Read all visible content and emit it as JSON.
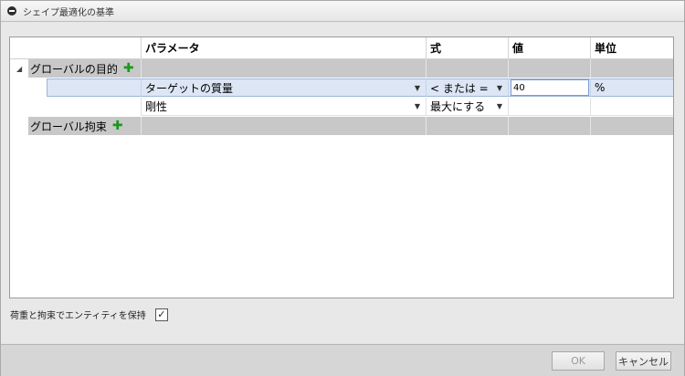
{
  "window": {
    "title": "シェイプ最適化の基準"
  },
  "grid": {
    "headers": [
      "パラメータ",
      "式",
      "値",
      "単位"
    ],
    "groups": [
      {
        "label": "グローバルの目的",
        "rows": [
          {
            "parameter": "ターゲットの質量",
            "expression": "< または =",
            "value": "40",
            "unit": "%"
          },
          {
            "parameter": "剛性",
            "expression": "最大にする",
            "value": "",
            "unit": ""
          }
        ]
      },
      {
        "label": "グローバル拘束",
        "rows": []
      }
    ]
  },
  "options": {
    "keep_loads_label": "荷重と拘束でエンティティを保持",
    "keep_loads_checked": true
  },
  "buttons": {
    "ok": "OK",
    "cancel": "キャンセル"
  },
  "colors": {
    "group_bg": "#c8c8c8",
    "selected_row_bg": "#dce6f5",
    "add_icon": "#1a9a1a"
  }
}
